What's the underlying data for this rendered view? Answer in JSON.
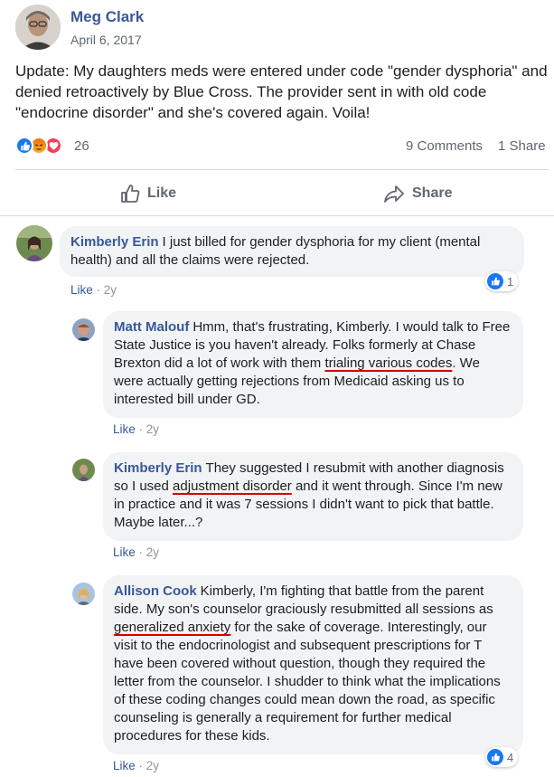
{
  "post": {
    "author": "Meg Clark",
    "date": "April 6, 2017",
    "text": "Update: My daughters meds were entered under code \"gender dysphoria\" and denied retroactively by Blue Cross. The provider sent in with old code \"endocrine disorder\" and she's covered again. Voila!",
    "reaction_count": "26",
    "reaction_icons": [
      "like-icon",
      "angry-icon",
      "love-icon"
    ],
    "comments_label": "9 Comments",
    "shares_label": "1 Share"
  },
  "actions": {
    "like_label": "Like",
    "share_label": "Share"
  },
  "comments": [
    {
      "author": "Kimberly Erin",
      "segments": [
        {
          "t": "I just billed for gender dysphoria for my client (mental health) and all the claims were rejected."
        }
      ],
      "like_label": "Like",
      "age": "2y",
      "reaction_count": "1"
    },
    {
      "author": "Matt Malouf",
      "segments": [
        {
          "t": "Hmm, that's frustrating, Kimberly. I would talk to Free State Justice is you haven't already. Folks formerly at Chase Brexton did a lot of work with them "
        },
        {
          "t": "trialing various codes",
          "hl": true
        },
        {
          "t": ". We were actually getting rejections from Medicaid asking us to interested bill under GD."
        }
      ],
      "like_label": "Like",
      "age": "2y"
    },
    {
      "author": "Kimberly Erin",
      "segments": [
        {
          "t": "They suggested I resubmit with another diagnosis so I used "
        },
        {
          "t": "adjustment disorder",
          "hl": true
        },
        {
          "t": " and it went through. Since I'm new in practice and it was 7 sessions I didn't want to pick that battle. Maybe later...?"
        }
      ],
      "like_label": "Like",
      "age": "2y"
    },
    {
      "author": "Allison Cook",
      "segments": [
        {
          "t": "Kimberly, I'm fighting that battle from the parent side. My son's counselor graciously resubmitted all sessions as "
        },
        {
          "t": "generalized anxiety",
          "hl": true
        },
        {
          "t": " for the sake of coverage. Interestingly, our visit to the endocrinologist and subsequent prescriptions for T have been covered without question, though they required the letter from the counselor. I shudder to think what the implications of these coding changes could mean down the road, as specific counseling is generally a requirement for further medical procedures for these kids."
        }
      ],
      "like_label": "Like",
      "age": "2y",
      "reaction_count": "4"
    }
  ],
  "colors": {
    "name_link": "#385898",
    "meta_gray": "#606770",
    "bubble_bg": "#f2f3f5",
    "like_blue": "#1877f2",
    "underline_red": "#d20000"
  }
}
